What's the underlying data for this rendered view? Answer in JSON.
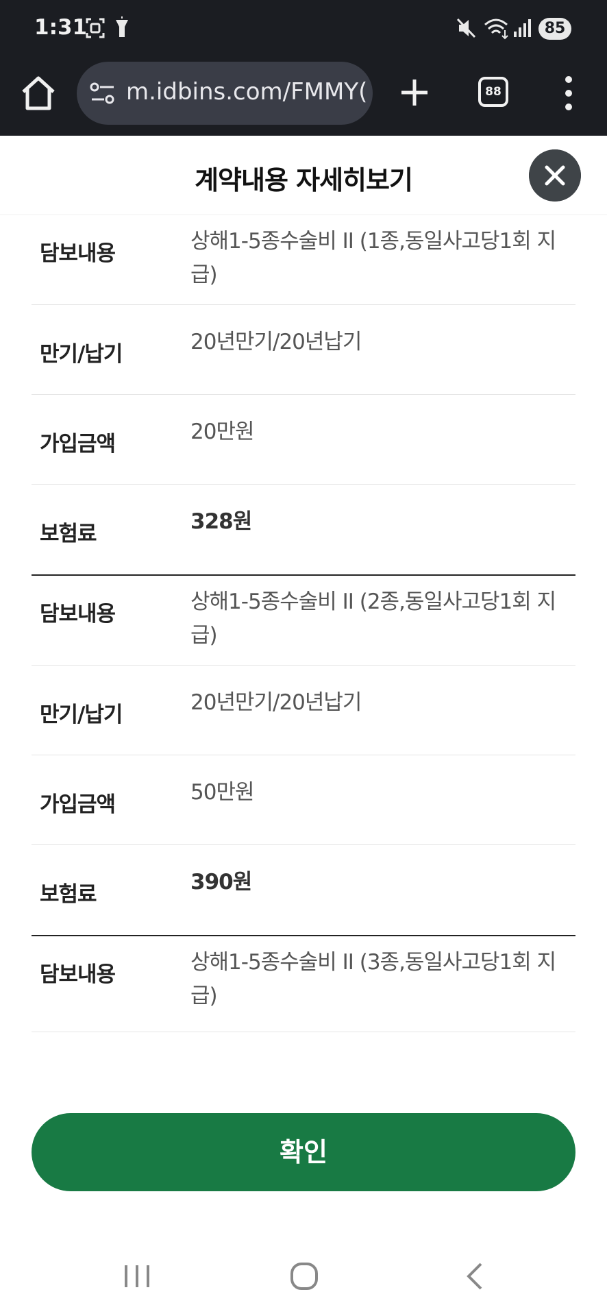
{
  "status_bar": {
    "time": "1:31",
    "battery": "85"
  },
  "browser": {
    "url": "m.idbins.com/FMMY(",
    "tab_count": "88"
  },
  "modal": {
    "title": "계약내용 자세히보기"
  },
  "rows": [
    {
      "label": "담보내용",
      "value": "상해1-5종수술비 II (1종,동일사고당1회 지급)",
      "bold": false,
      "sep": false
    },
    {
      "label": "만기/납기",
      "value": "20년만기/20년납기",
      "bold": false,
      "sep": false
    },
    {
      "label": "가입금액",
      "value": "20만원",
      "bold": false,
      "sep": false
    },
    {
      "label": "보험료",
      "value": "328원",
      "bold": true,
      "sep": true
    },
    {
      "label": "담보내용",
      "value": "상해1-5종수술비 II (2종,동일사고당1회 지급)",
      "bold": false,
      "sep": false
    },
    {
      "label": "만기/납기",
      "value": "20년만기/20년납기",
      "bold": false,
      "sep": false
    },
    {
      "label": "가입금액",
      "value": "50만원",
      "bold": false,
      "sep": false
    },
    {
      "label": "보험료",
      "value": "390원",
      "bold": true,
      "sep": true
    },
    {
      "label": "담보내용",
      "value": "상해1-5종수술비 II (3종,동일사고당1회 지급)",
      "bold": false,
      "sep": false
    }
  ],
  "confirm_label": "확인",
  "icons": {
    "home": "home-icon",
    "tune": "tune-icon",
    "plus": "plus-icon",
    "menu": "more-vert-icon",
    "close": "close-icon",
    "nav_recent": "recent-apps-icon",
    "nav_home": "home-circle-icon",
    "nav_back": "back-icon"
  },
  "colors": {
    "confirm_button": "#187a44",
    "top_bar": "#1b1d22"
  }
}
